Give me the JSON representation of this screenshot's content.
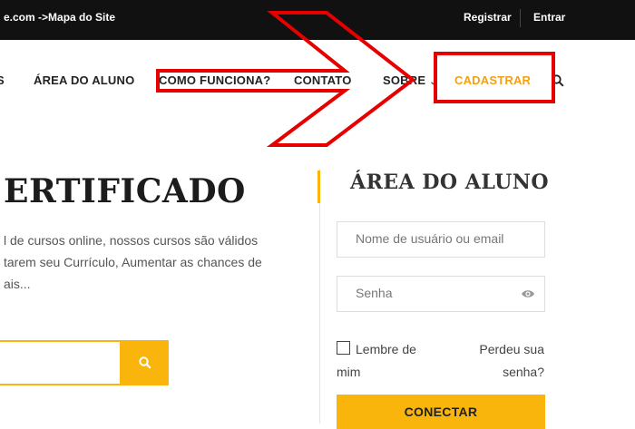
{
  "topbar": {
    "breadcrumb": "e.com ->Mapa do Site",
    "register": "Registrar",
    "login": "Entrar"
  },
  "nav": {
    "cut_item": "S",
    "items": [
      "ÁREA DO ALUNO",
      "COMO FUNCIONA?",
      "CONTATO",
      "SOBRE",
      "CADASTRAR"
    ],
    "search_icon": "search-icon"
  },
  "hero": {
    "title": "ERTIFICADO",
    "text_lines": [
      "l de cursos online, nossos cursos são válidos",
      "tarem seu Currículo, Aumentar as chances de",
      "ais..."
    ],
    "search_button_icon": "search-icon"
  },
  "sidebar": {
    "title": "ÁREA DO ALUNO",
    "username_placeholder": "Nome de usuário ou email",
    "password_placeholder": "Senha",
    "remember_line1": "Lembre de",
    "remember_line2": "mim",
    "lost_line1": "Perdeu sua",
    "lost_line2": "senha?",
    "connect": "CONECTAR"
  },
  "colors": {
    "accent": "#f9b50b",
    "nav_highlight": "#f4a013",
    "annotation": "#e60000",
    "topbar": "#111111"
  }
}
